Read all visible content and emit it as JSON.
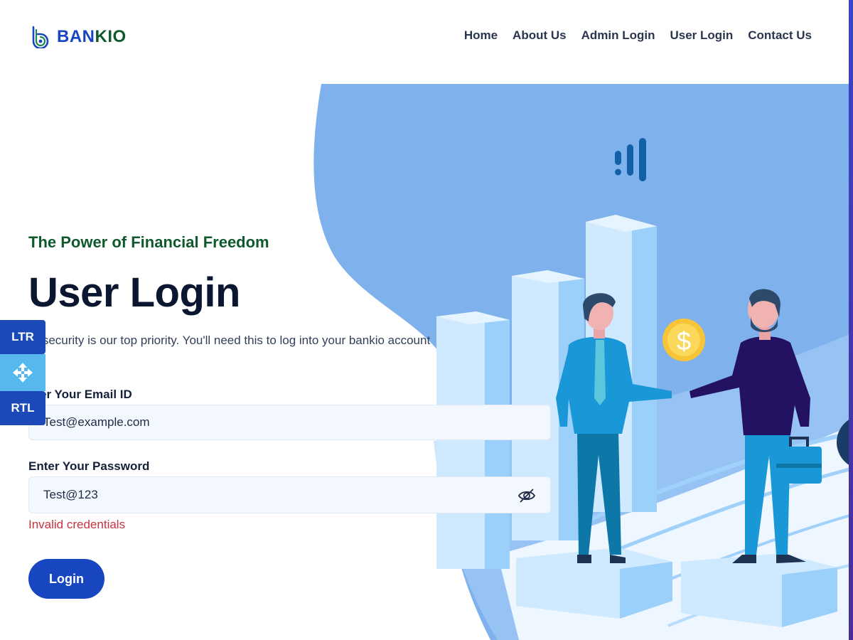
{
  "brand": {
    "name_part1": "BAN",
    "name_part2": "KIO",
    "logo_icon": "bankio-logo-icon"
  },
  "nav": {
    "items": [
      {
        "label": "Home"
      },
      {
        "label": "About Us"
      },
      {
        "label": "Admin Login"
      },
      {
        "label": "User Login"
      },
      {
        "label": "Contact Us"
      }
    ]
  },
  "hero": {
    "tagline": "The Power of Financial Freedom",
    "title": "User Login",
    "description": "ur security is our top priority. You'll need this to log into your bankio account"
  },
  "form": {
    "email_label": "nter Your Email ID",
    "email_value": "Test@example.com",
    "password_label": "Enter Your Password",
    "password_value": "Test@123",
    "password_toggle_icon": "eye-slash-icon",
    "error": "Invalid credentials",
    "submit_label": "Login"
  },
  "side_tools": {
    "ltr_label": "LTR",
    "move_icon": "move-arrows-icon",
    "rtl_label": "RTL"
  },
  "illustration": {
    "coin_symbol": "$"
  },
  "colors": {
    "primary": "#1846c0",
    "brand_green": "#0f5a2c",
    "error": "#c8343d",
    "hero_blue": "#7fb1ec",
    "field_bg": "#f3f8fe"
  }
}
